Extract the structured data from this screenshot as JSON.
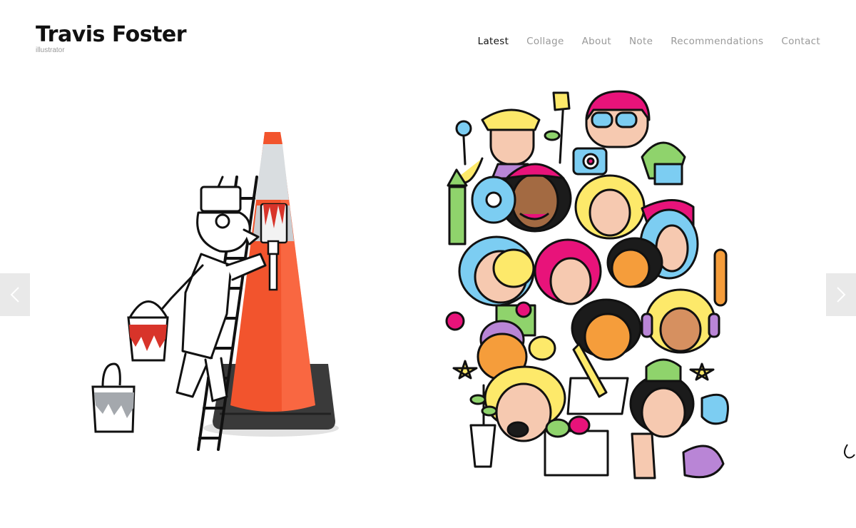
{
  "site": {
    "title": "Travis Foster",
    "tagline": "illustrator"
  },
  "nav": {
    "items": [
      {
        "label": "Latest",
        "active": true
      },
      {
        "label": "Collage"
      },
      {
        "label": "About"
      },
      {
        "label": "Note"
      },
      {
        "label": "Recommendations"
      },
      {
        "label": "Contact"
      }
    ]
  },
  "slider": {
    "slides": [
      {
        "subject": "drawn painter on ladder painting a real traffic cone"
      },
      {
        "subject": "crowd of colorful cartoon faces with plants and objects"
      }
    ],
    "prev_icon": "chevron-left-icon",
    "next_icon": "chevron-right-icon"
  },
  "colors": {
    "accent_cone": "#f2542d",
    "pink": "#e8137a",
    "yellow": "#fde96a",
    "blue": "#7ccdf2",
    "green": "#8fd36c",
    "purple": "#b985d6",
    "arrow_bg": "#e9e9e9"
  }
}
